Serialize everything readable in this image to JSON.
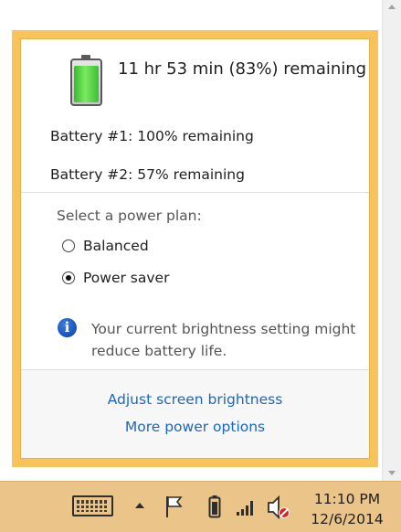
{
  "battery": {
    "summary": "11 hr 53 min (83%) remaining",
    "charge_fraction": 0.83,
    "battery1": "Battery #1: 100% remaining",
    "battery2": "Battery #2: 57% remaining"
  },
  "power_plan": {
    "label": "Select a power plan:",
    "options": [
      {
        "label": "Balanced",
        "selected": false
      },
      {
        "label": "Power saver",
        "selected": true
      }
    ]
  },
  "info": {
    "icon": "info-icon",
    "text": "Your current brightness setting might reduce battery life."
  },
  "links": {
    "adjust_brightness": "Adjust screen brightness",
    "more_power_options": "More power options"
  },
  "taskbar": {
    "time": "11:10 PM",
    "date": "12/6/2014",
    "icons": [
      "touch-keyboard-icon",
      "show-hidden-icons-chevron",
      "action-center-flag-icon",
      "battery-icon",
      "network-signal-icon",
      "speaker-muted-icon"
    ]
  },
  "colors": {
    "flyout_border": "#f7c35a",
    "taskbar": "#eac489",
    "link": "#1a66c7",
    "battery_fill": "#4fd13f"
  }
}
